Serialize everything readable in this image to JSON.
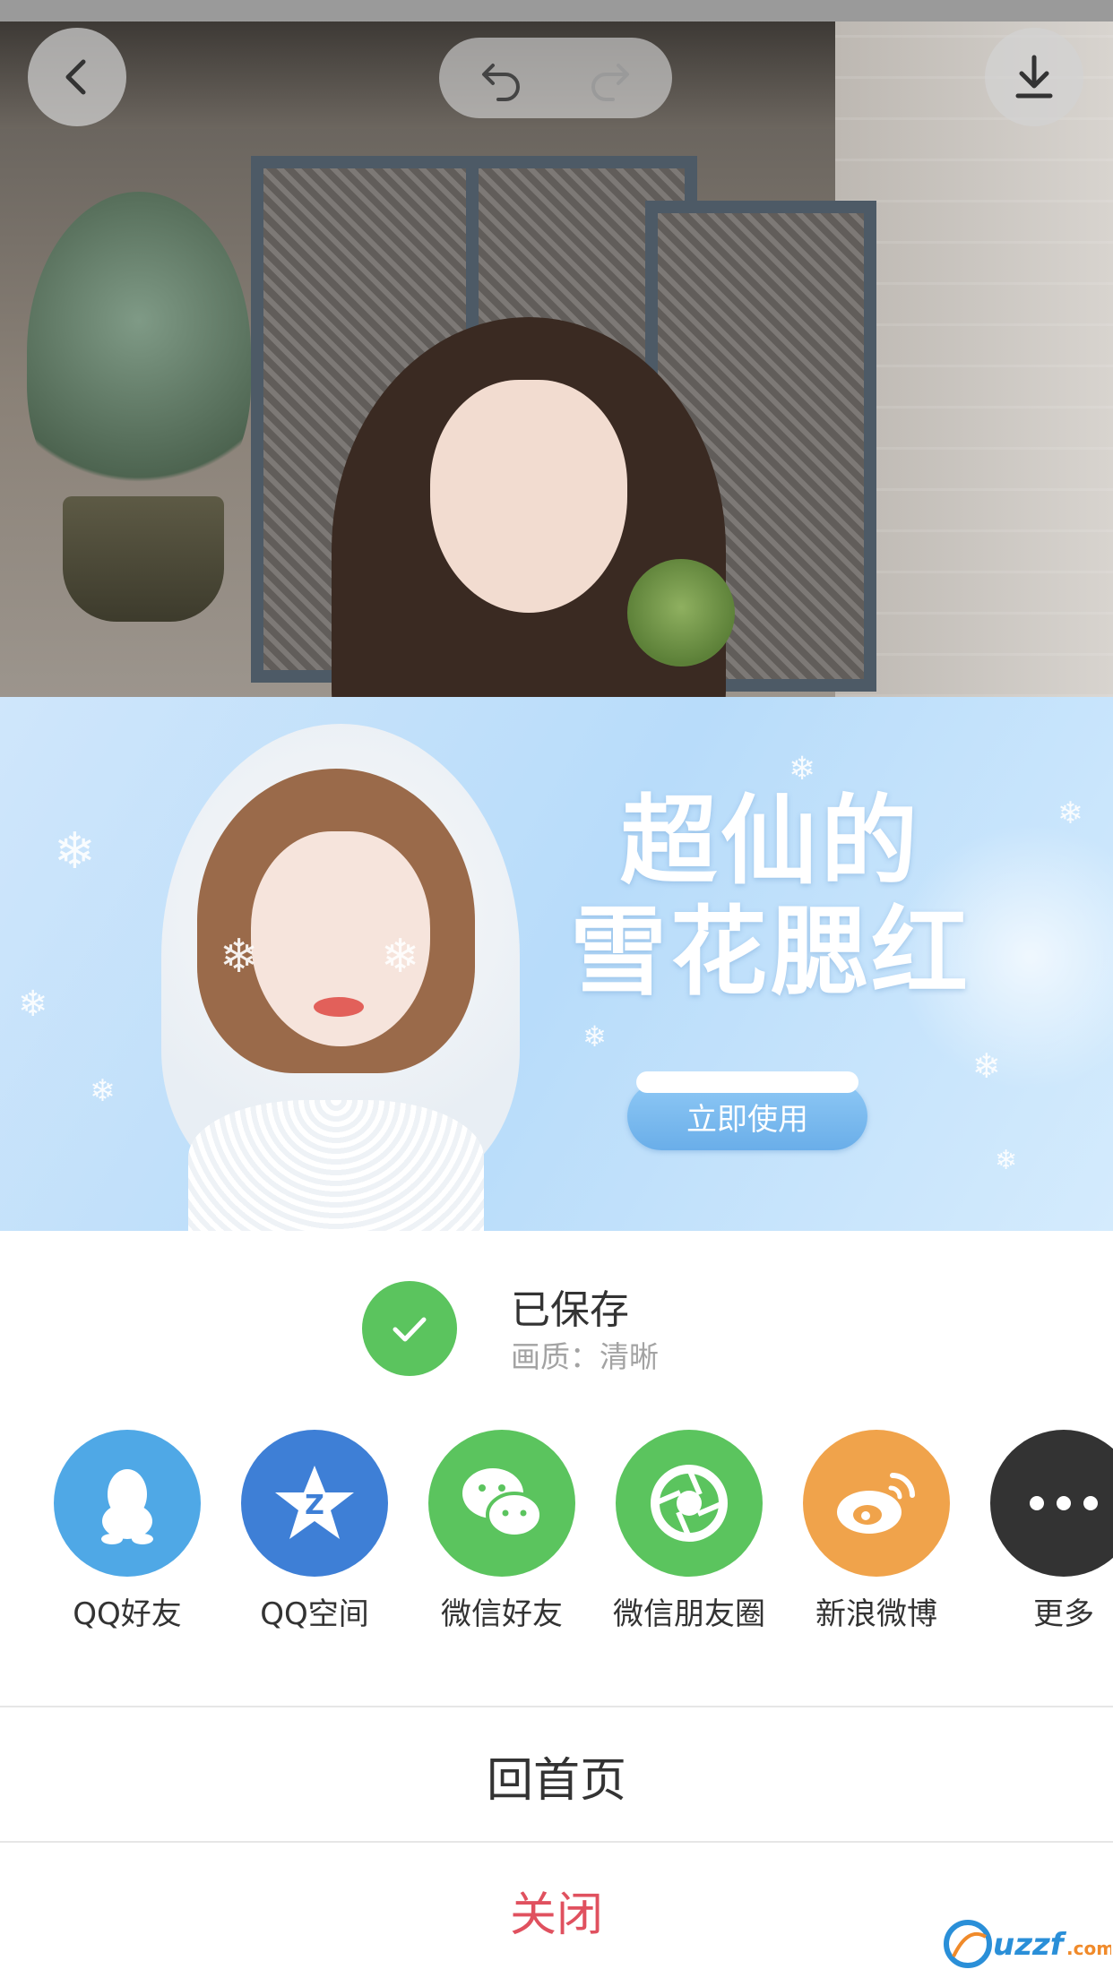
{
  "photo": {
    "back_icon": "chevron-left-icon",
    "undo_icon": "undo-icon",
    "redo_icon": "redo-icon",
    "download_icon": "download-icon"
  },
  "banner": {
    "title_line1": "超仙的",
    "title_line2": "雪花腮红",
    "button_label": "立即使用"
  },
  "saved": {
    "title": "已保存",
    "quality": "画质：清晰",
    "icon": "check-icon",
    "color": "#5bc45e"
  },
  "share": {
    "items": [
      {
        "label": "QQ好友",
        "icon": "qq-icon",
        "color": "#4fa8e6"
      },
      {
        "label": "QQ空间",
        "icon": "qzone-icon",
        "color": "#3e7fd6"
      },
      {
        "label": "微信好友",
        "icon": "wechat-icon",
        "color": "#5bc45e"
      },
      {
        "label": "微信朋友圈",
        "icon": "moments-icon",
        "color": "#5bc45e"
      },
      {
        "label": "新浪微博",
        "icon": "weibo-icon",
        "color": "#f0a34b"
      },
      {
        "label": "更多",
        "icon": "more-icon",
        "color": "#333333"
      }
    ]
  },
  "actions": {
    "home": "回首页",
    "close": "关闭"
  },
  "watermark": {
    "text": "uzzf.com"
  }
}
